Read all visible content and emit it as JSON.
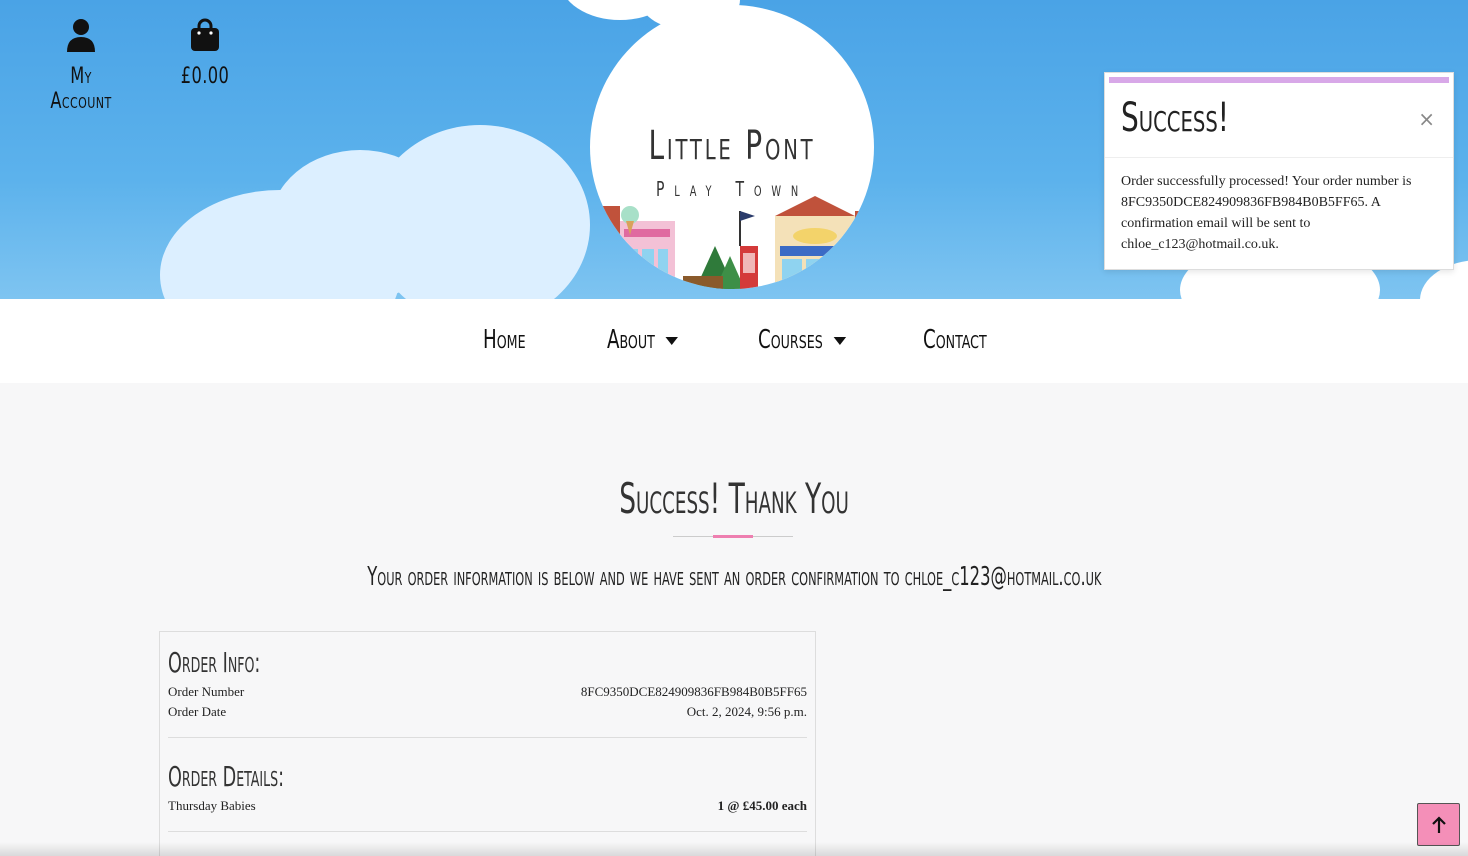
{
  "header": {
    "account_label": "My Account",
    "basket_total": "£0.00",
    "logo_title": "Little Pont",
    "logo_subtitle": "Play Town"
  },
  "toast": {
    "title": "Success!",
    "close": "×",
    "message": "Order successfully processed! Your order number is 8FC9350DCE824909836FB984B0B5FF65. A confirmation email will be sent to chloe_c123@hotmail.co.uk."
  },
  "nav": {
    "home": "Home",
    "about": "About",
    "courses": "Courses",
    "contact": "Contact"
  },
  "main": {
    "heading": "Success! Thank You",
    "subheading": "Your order information is below and we have sent an order confirmation to chloe_c123@hotmail.co.uk"
  },
  "order_info": {
    "title": "Order Info:",
    "number_label": "Order Number",
    "number_value": "8FC9350DCE824909836FB984B0B5FF65",
    "date_label": "Order Date",
    "date_value": "Oct. 2, 2024, 9:56 p.m."
  },
  "order_details": {
    "title": "Order Details:",
    "item_name": "Thursday Babies",
    "item_qty_price": "1 @ £45.00 each"
  },
  "colors": {
    "sky": "#5cb2ec",
    "accent_pink": "#f48fb8",
    "toast_bar": "#d8a8e8"
  },
  "icons": {
    "account": "person-icon",
    "basket": "shopping-bag-icon",
    "back_to_top": "arrow-up-icon"
  }
}
